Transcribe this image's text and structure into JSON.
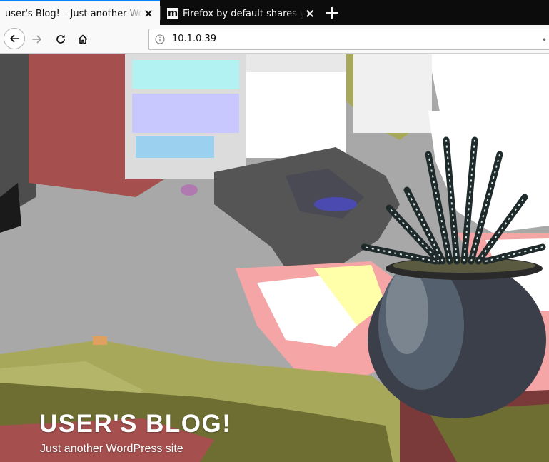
{
  "tabs": [
    {
      "title": "user's Blog! – Just another WordPress site",
      "active": true
    },
    {
      "title": "Firefox by default shares your search",
      "favicon": "m",
      "active": false
    }
  ],
  "navbar": {
    "url": "10.1.0.39",
    "icons": {
      "back": "arrow-left-icon",
      "forward": "arrow-right-icon",
      "reload": "reload-icon",
      "home": "home-icon",
      "info": "info-icon",
      "page_actions": "more-dots-icon"
    },
    "page_actions_glyph": "•••"
  },
  "site": {
    "title": "USER'S BLOG!",
    "tagline": "Just another WordPress site"
  },
  "colors": {
    "tab_accent": "#0a84ff",
    "tabbar_bg": "#0c0c0d",
    "toolbar_bg": "#f9f9fa"
  }
}
